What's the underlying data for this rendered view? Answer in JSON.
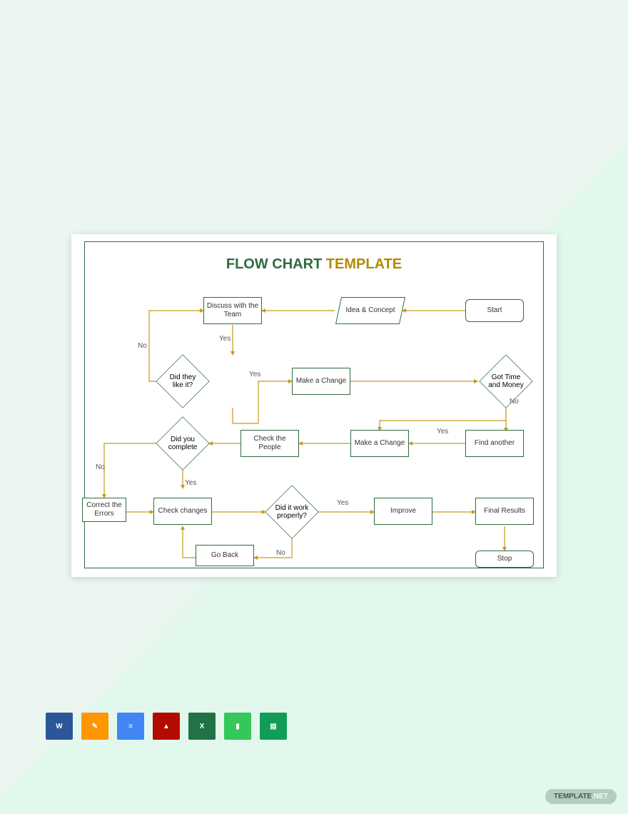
{
  "title": {
    "a": "FLOW CHART ",
    "b": "TEMPLATE"
  },
  "nodes": {
    "start": "Start",
    "idea": "Idea & Concept",
    "discuss": "Discuss with the Team",
    "like": "Did they like it?",
    "change1": "Make a Change",
    "gtm": "Got Time and Money",
    "find": "Find another",
    "change2": "Make a Change",
    "check_people": "Check the People",
    "complete": "Did you complete",
    "correct": "Correct the Errors",
    "check_changes": "Check changes",
    "work": "Did it work properly?",
    "improve": "Improve",
    "final": "Final Results",
    "goback": "Go Back",
    "stop": "Stop"
  },
  "labels": {
    "yes": "Yes",
    "no": "No"
  },
  "brand": {
    "a": "TEMPLATE",
    "b": ".NET"
  },
  "chart_data": {
    "type": "flowchart",
    "title": "FLOW CHART TEMPLATE",
    "nodes": [
      {
        "id": "start",
        "kind": "terminator",
        "label": "Start"
      },
      {
        "id": "idea",
        "kind": "data",
        "label": "Idea & Concept"
      },
      {
        "id": "discuss",
        "kind": "process",
        "label": "Discuss with the Team"
      },
      {
        "id": "like",
        "kind": "decision",
        "label": "Did they like it?"
      },
      {
        "id": "change1",
        "kind": "process",
        "label": "Make a Change"
      },
      {
        "id": "gtm",
        "kind": "decision",
        "label": "Got Time and Money"
      },
      {
        "id": "find",
        "kind": "process",
        "label": "Find another"
      },
      {
        "id": "change2",
        "kind": "process",
        "label": "Make a Change"
      },
      {
        "id": "check_people",
        "kind": "process",
        "label": "Check the People"
      },
      {
        "id": "complete",
        "kind": "decision",
        "label": "Did you complete"
      },
      {
        "id": "correct",
        "kind": "process",
        "label": "Correct the Errors"
      },
      {
        "id": "check_changes",
        "kind": "process",
        "label": "Check changes"
      },
      {
        "id": "work",
        "kind": "decision",
        "label": "Did it work properly?"
      },
      {
        "id": "improve",
        "kind": "process",
        "label": "Improve"
      },
      {
        "id": "final",
        "kind": "process",
        "label": "Final Results"
      },
      {
        "id": "goback",
        "kind": "process",
        "label": "Go Back"
      },
      {
        "id": "stop",
        "kind": "terminator",
        "label": "Stop"
      }
    ],
    "edges": [
      {
        "from": "start",
        "to": "idea"
      },
      {
        "from": "idea",
        "to": "discuss"
      },
      {
        "from": "discuss",
        "to": "like",
        "label": "Yes"
      },
      {
        "from": "like",
        "to": "change1",
        "label": "Yes"
      },
      {
        "from": "like",
        "to": "discuss",
        "label": "No"
      },
      {
        "from": "change1",
        "to": "gtm"
      },
      {
        "from": "gtm",
        "to": "change2",
        "label": "Yes"
      },
      {
        "from": "gtm",
        "to": "find",
        "label": "No"
      },
      {
        "from": "find",
        "to": "change2"
      },
      {
        "from": "change2",
        "to": "check_people"
      },
      {
        "from": "check_people",
        "to": "complete"
      },
      {
        "from": "complete",
        "to": "check_changes",
        "label": "Yes"
      },
      {
        "from": "complete",
        "to": "correct",
        "label": "No"
      },
      {
        "from": "correct",
        "to": "check_changes"
      },
      {
        "from": "check_changes",
        "to": "work"
      },
      {
        "from": "work",
        "to": "improve",
        "label": "Yes"
      },
      {
        "from": "work",
        "to": "goback",
        "label": "No"
      },
      {
        "from": "goback",
        "to": "check_changes"
      },
      {
        "from": "improve",
        "to": "final"
      },
      {
        "from": "final",
        "to": "stop"
      }
    ]
  }
}
